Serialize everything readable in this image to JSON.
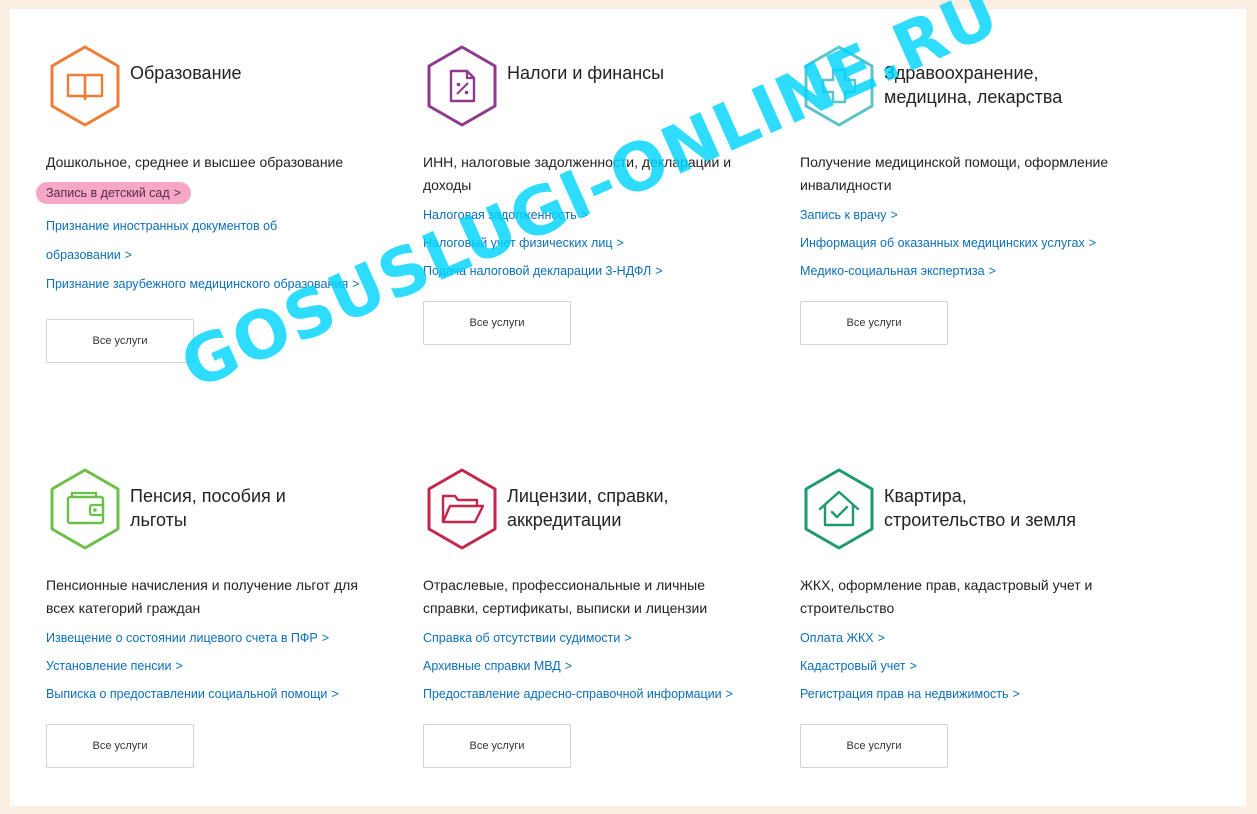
{
  "categories": [
    {
      "title": "Образование",
      "icon": "book-icon",
      "color": "#ee7d35",
      "description": "Дошкольное, среднее и высшее образование",
      "links": [
        "Запись в детский сад",
        "Признание иностранных документов об образовании",
        "Признание зарубежного медицинского образования"
      ],
      "button": "Все услуги"
    },
    {
      "title": "Налоги и финансы",
      "icon": "tax-document-icon",
      "color": "#8e3a8c",
      "description": "ИНН, налоговые задолженности, декларации и доходы",
      "links": [
        "Налоговая задолженность",
        "Налоговый учет физических лиц",
        "Подача налоговой декларации 3-НДФЛ"
      ],
      "button": "Все услуги"
    },
    {
      "title": "Здравоохранение,\nмедицина, лекарства",
      "icon": "medical-cross-icon",
      "color": "#5cc4c8",
      "description": "Получение медицинской помощи, оформление инвалидности",
      "links": [
        "Запись к врачу",
        "Информация об оказанных медицинских услугах",
        "Медико-социальная экспертиза"
      ],
      "button": "Все услуги"
    },
    {
      "title": "Пенсия, пособия и\nльготы",
      "icon": "wallet-icon",
      "color": "#6cc04a",
      "description": "Пенсионные начисления и получение льгот для всех категорий граждан",
      "links": [
        "Извещение о состоянии лицевого счета в ПФР",
        "Установление пенсии",
        "Выписка о предоставлении социальной помощи"
      ],
      "button": "Все услуги"
    },
    {
      "title": "Лицензии, справки,\nаккредитации",
      "icon": "folder-icon",
      "color": "#c4264c",
      "description": "Отраслевые, профессиональные и личные справки, сертификаты, выписки и лицензии",
      "links": [
        "Справка об отсутствии судимости",
        "Архивные справки МВД",
        "Предоставление адресно-справочной информации"
      ],
      "button": "Все услуги"
    },
    {
      "title": "Квартира,\nстроительство и земля",
      "icon": "house-check-icon",
      "color": "#1f9a6e",
      "description": "ЖКХ, оформление прав, кадастровый учет и строительство",
      "links": [
        "Оплата ЖКХ",
        "Кадастровый учет",
        "Регистрация прав на недвижимость"
      ],
      "button": "Все услуги"
    }
  ],
  "link_arrow": ">",
  "highlight_color": "#f4a7c6",
  "watermark": "GOSUSLUGI-ONLINE.RU"
}
